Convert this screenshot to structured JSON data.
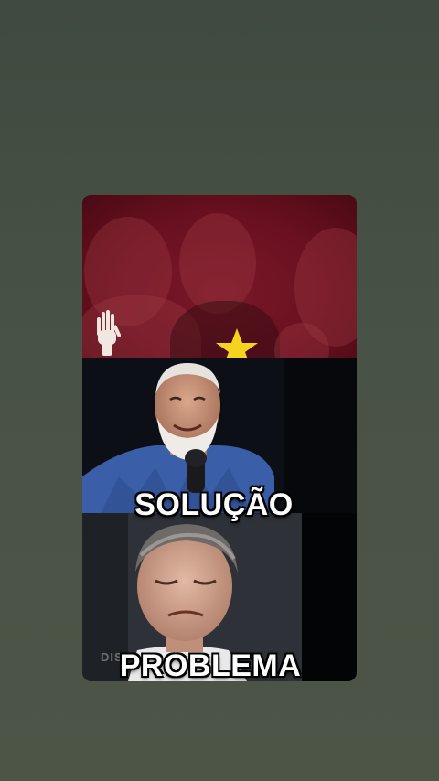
{
  "captions": {
    "top": "SOLUÇÃO",
    "bottom": "PROBLEMA"
  },
  "watermark": "DISPUNDOS",
  "colors": {
    "background": "#4b5448",
    "banner_red": "#6a1020",
    "star_yellow": "#f6d31c",
    "caption_text": "#ffffff"
  },
  "icons": [
    "star-icon",
    "raised-hand-icon"
  ]
}
